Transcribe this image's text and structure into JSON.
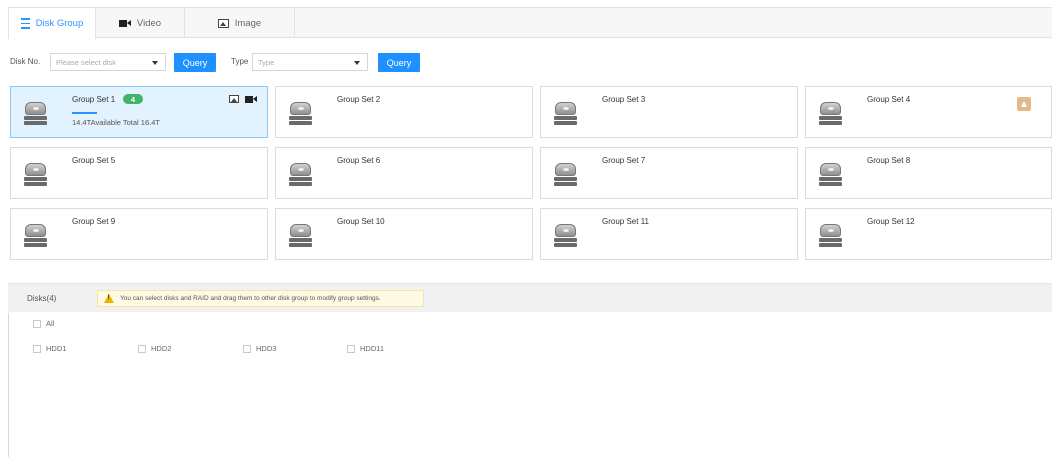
{
  "tabs": [
    {
      "label": "Disk Group",
      "icon": "list-icon",
      "active": true
    },
    {
      "label": "Video",
      "icon": "video-icon",
      "active": false
    },
    {
      "label": "Image",
      "icon": "image-icon",
      "active": false
    }
  ],
  "filters": {
    "disk_label": "Disk No.",
    "disk_placeholder": "Please select disk",
    "query1": "Query",
    "type_label": "Type",
    "type_placeholder": "Type",
    "query2": "Query"
  },
  "groups": [
    {
      "name": "Group Set 1",
      "count": "4",
      "capacity": "14.4TAvailable Total 16.4T",
      "selected": true
    },
    {
      "name": "Group Set 2"
    },
    {
      "name": "Group Set 3"
    },
    {
      "name": "Group Set 4",
      "warning": true
    },
    {
      "name": "Group Set 5"
    },
    {
      "name": "Group Set 6"
    },
    {
      "name": "Group Set 7"
    },
    {
      "name": "Group Set 8"
    },
    {
      "name": "Group Set 9"
    },
    {
      "name": "Group Set 10"
    },
    {
      "name": "Group Set 11"
    },
    {
      "name": "Group Set 12"
    }
  ],
  "disks": {
    "count_label": "Disks(4)",
    "tip": "You can select disks and RAID and drag them to other disk group to modify group settings.",
    "all_label": "All",
    "items": [
      "HDD1",
      "HDD2",
      "HDD3",
      "HDD11"
    ]
  },
  "colors": {
    "accent": "#2a95ff",
    "button": "#1e90ff",
    "badge": "#44b36a",
    "selected_bg": "#e2f2fe",
    "tip_bg": "#fdf9e2"
  }
}
